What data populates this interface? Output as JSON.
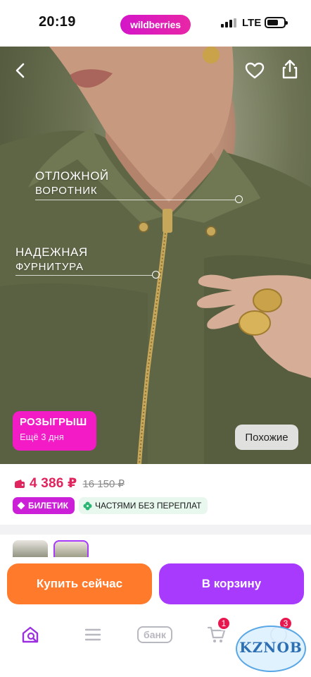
{
  "status_bar": {
    "time": "20:19",
    "url": "wildberries",
    "network": "LTE"
  },
  "photo": {
    "callouts": [
      {
        "line1": "ОТЛОЖНОЙ",
        "line2": "ВОРОТНИК"
      },
      {
        "line1": "НАДЕЖНАЯ",
        "line2": "ФУРНИТУРА"
      }
    ],
    "raffle": {
      "title": "РОЗЫГРЫШ",
      "subtitle": "Ещё 3 дня"
    },
    "similar_label": "Похожие",
    "icons": {
      "back": "chevron-left-icon",
      "favorite": "heart-icon",
      "share": "share-icon"
    }
  },
  "price": {
    "current": "4 386 ₽",
    "old": "16 150 ₽",
    "current_color": "#e0245e"
  },
  "badges": [
    {
      "label": "БИЛЕТИК",
      "color": "#cc20d8"
    },
    {
      "label": "ЧАСТЯМИ БЕЗ ПЕРЕПЛАТ",
      "color": "#e8f8ee"
    }
  ],
  "actions": {
    "buy_now": "Купить сейчас",
    "add_to_cart": "В корзину",
    "buy_now_color": "#ff7a2b",
    "add_to_cart_color": "#a73afd"
  },
  "tabbar": {
    "bank_label": "банк",
    "cart_count": "1",
    "profile_count": "3",
    "icons": [
      "home-search-icon",
      "menu-icon",
      "bank-icon",
      "cart-icon",
      "profile-icon"
    ]
  },
  "watermark": {
    "text": "KZNOB"
  }
}
